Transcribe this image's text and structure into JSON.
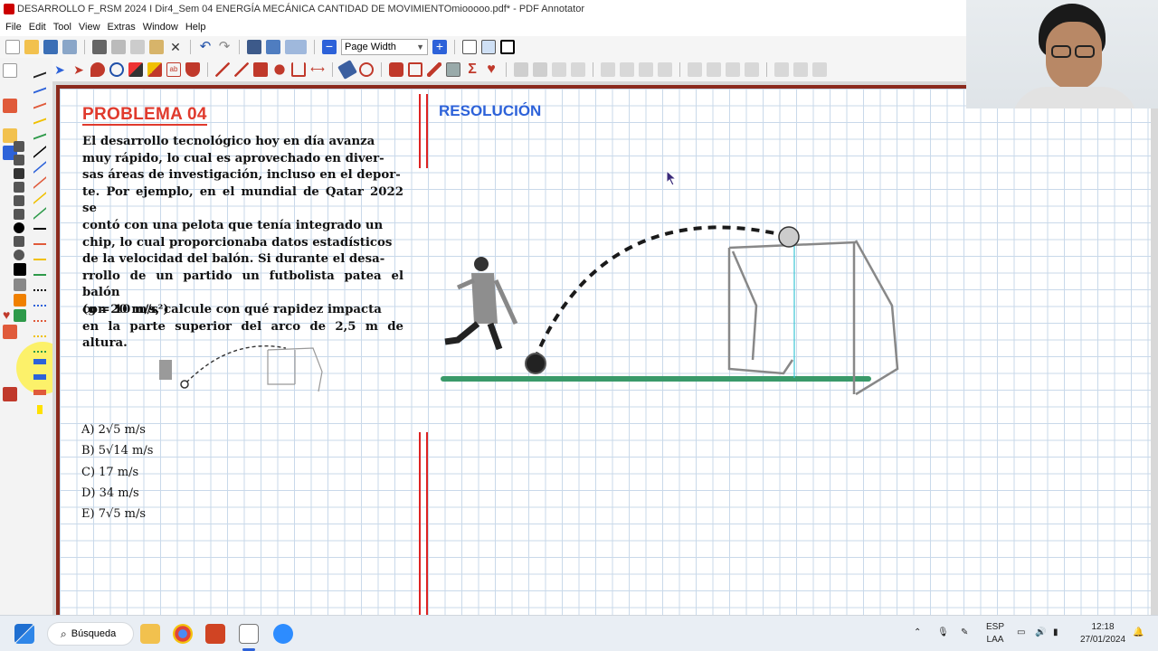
{
  "window": {
    "title": "DESARROLLO F_RSM 2024 I Dir4_Sem 04 ENERGÍA MECÁNICA CANTIDAD DE MOVIMIENTOmiooooo.pdf* - PDF Annotator"
  },
  "menu": [
    "File",
    "Edit",
    "Tool",
    "View",
    "Extras",
    "Window",
    "Help"
  ],
  "toolbar": {
    "zoom_value": "Page Width"
  },
  "document": {
    "problem_title": "PROBLEMA 04",
    "problem_lines": [
      "El desarrollo tecnológico hoy en día avanza",
      "muy rápido, lo cual es aprovechado en diver-",
      "sas áreas de investigación, incluso en el depor-",
      "te. Por ejemplo, en el mundial de Qatar 2022 se",
      "contó con una pelota que tenía integrado un",
      "chip, lo cual proporcionaba datos estadísticos",
      "de la velocidad del balón. Si durante el desa-",
      "rrollo de un partido un futbolista patea el balón",
      "con 20 m/s, calcule con qué rapidez impacta",
      "en la parte superior del arco de 2,5 m de altura."
    ],
    "gravity_note": "(g = 10 m/s²)",
    "options": [
      "A) 2√5 m/s",
      "B) 5√14 m/s",
      "C) 17 m/s",
      "D) 34 m/s",
      "E) 7√5 m/s"
    ],
    "resolution_heading": "RESOLUCIÓN"
  },
  "taskbar": {
    "search_label": "Búsqueda",
    "lang_top": "ESP",
    "lang_bottom": "LAA",
    "time": "12:18",
    "date": "27/01/2024"
  },
  "colors": {
    "accent_red": "#e03a2d",
    "heading_blue": "#2d62d9",
    "ground_green": "#3a9a6a",
    "grid": "#c9d9ea"
  }
}
